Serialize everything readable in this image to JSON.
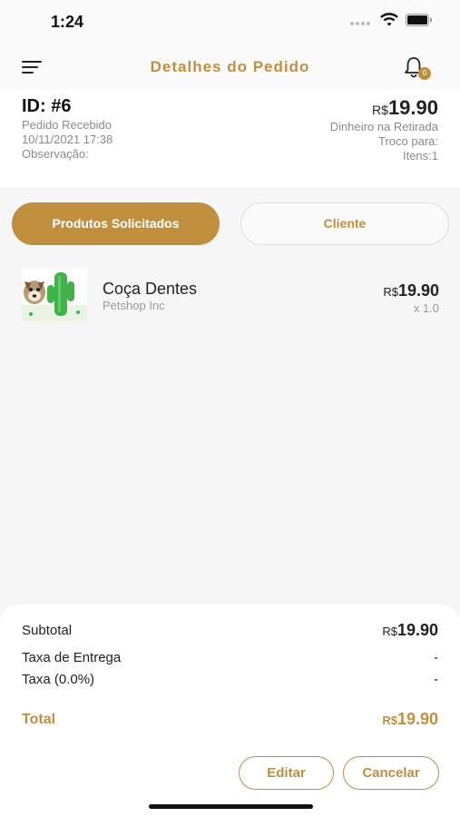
{
  "status_bar": {
    "time": "1:24"
  },
  "header": {
    "title": "Detalhes do Pedido",
    "notification_count": "0",
    "icons": {
      "menu": "menu-icon",
      "bell": "bell-icon"
    }
  },
  "order": {
    "id": "ID: #6",
    "status": "Pedido Recebido",
    "datetime": "10/11/2021 17:38",
    "note_label": "Observação:",
    "currency": "R$",
    "price": "19.90",
    "payment": "Dinheiro na Retirada",
    "change_label": "Troco para:",
    "items_label": "Itens:1"
  },
  "tabs": [
    {
      "label": "Produtos Solicitados",
      "active": true
    },
    {
      "label": "Cliente",
      "active": false
    }
  ],
  "products": [
    {
      "name": "Coça Dentes",
      "store": "Petshop Inc",
      "currency": "R$",
      "price": "19.90",
      "quantity": "x 1.0"
    }
  ],
  "summary": {
    "subtotal_label": "Subtotal",
    "subtotal_currency": "R$",
    "subtotal_value": "19.90",
    "delivery_label": "Taxa de Entrega",
    "delivery_value": "-",
    "tax_label": "Taxa (0.0%)",
    "tax_value": "-",
    "total_label": "Total",
    "total_currency": "R$",
    "total_value": "19.90"
  },
  "actions": {
    "edit_label": "Editar",
    "cancel_label": "Cancelar"
  },
  "colors": {
    "accent": "#c08f3e",
    "background": "#f6f6f6",
    "card": "#ffffff"
  }
}
